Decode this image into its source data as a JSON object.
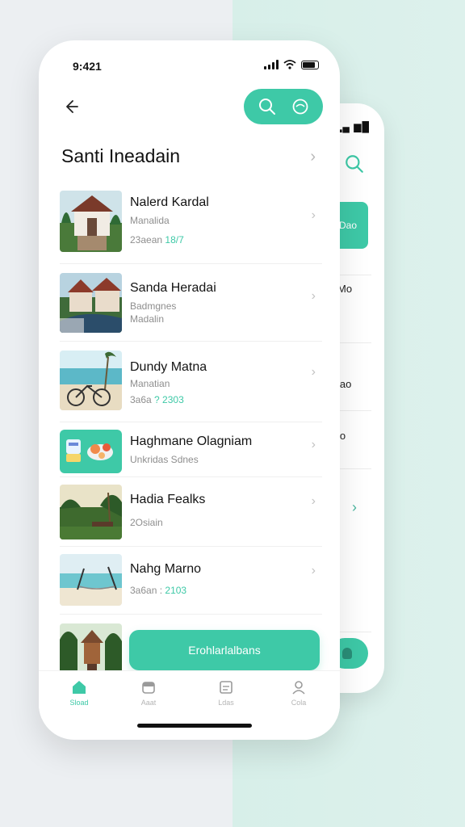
{
  "front": {
    "status_time": "9:421",
    "page_title": "Santi Ineadain",
    "items": [
      {
        "title": "Nalerd Kardal",
        "subtitle": "Manalida",
        "meta_prefix": "23aean",
        "meta_accent": "18/7"
      },
      {
        "title": "Sanda Heradai",
        "subtitle": "Badmgnes",
        "meta_prefix": "Madalin",
        "meta_accent": ""
      },
      {
        "title": "Dundy Matna",
        "subtitle": "Manatian",
        "meta_prefix": "3a6a",
        "meta_accent": "? 2303"
      },
      {
        "title": "Haghmane Olagniam",
        "subtitle": "Unkridas Sdnes",
        "meta_prefix": "",
        "meta_accent": ""
      },
      {
        "title": "Hadia Fealks",
        "subtitle": "2Osiain",
        "meta_prefix": "",
        "meta_accent": ""
      },
      {
        "title": "Nahg Marno",
        "subtitle": "3a6an :",
        "meta_prefix": "",
        "meta_accent": "2103"
      }
    ],
    "cta_label": "Erohlarlalbans",
    "tabs": [
      {
        "label": "Sload",
        "icon": "home-icon",
        "active": true
      },
      {
        "label": "Aaat",
        "icon": "box-icon",
        "active": false
      },
      {
        "label": "Ldas",
        "icon": "calendar-icon",
        "active": false
      },
      {
        "label": "Cola",
        "icon": "profile-icon",
        "active": false
      }
    ]
  },
  "back": {
    "pill_label": "Dao",
    "rows": [
      "Mo",
      "lao",
      "lo"
    ]
  },
  "colors": {
    "accent": "#3ec9a7",
    "text": "#141414",
    "muted": "#8e8e8e"
  }
}
